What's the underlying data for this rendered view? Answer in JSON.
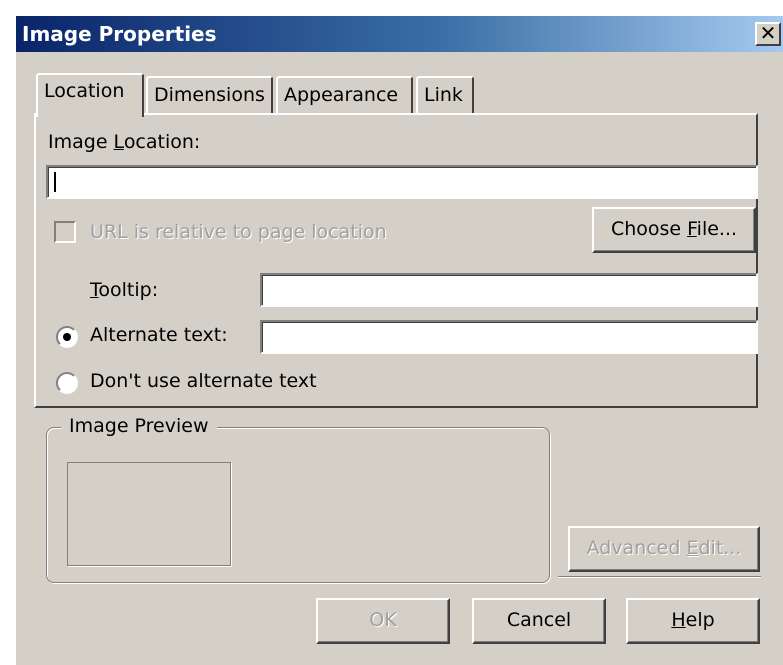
{
  "window": {
    "title": "Image Properties",
    "close_label": "✕"
  },
  "tabs": [
    {
      "label": "Location",
      "active": true
    },
    {
      "label": "Dimensions",
      "active": false
    },
    {
      "label": "Appearance",
      "active": false
    },
    {
      "label": "Link",
      "active": false
    }
  ],
  "location": {
    "image_location_label_pre": "Image ",
    "image_location_label_key": "L",
    "image_location_label_post": "ocation:",
    "image_location_value": "",
    "url_relative_label": "URL is relative to page location",
    "url_relative_checked": false,
    "choose_file_pre": "Choose ",
    "choose_file_key": "F",
    "choose_file_post": "ile...",
    "tooltip_key": "T",
    "tooltip_post": "ooltip:",
    "tooltip_value": "",
    "alt_text_label": "Alternate text:",
    "alt_text_value": "",
    "alt_text_selected": true,
    "no_alt_text_label": "Don't use alternate text",
    "no_alt_text_selected": false
  },
  "preview": {
    "legend": "Image Preview"
  },
  "buttons": {
    "advanced_edit_pre": "Advanced ",
    "advanced_edit_key": "E",
    "advanced_edit_post": "dit...",
    "ok": "OK",
    "cancel": "Cancel",
    "help_key": "H",
    "help_post": "elp"
  },
  "colors": {
    "title_gradient_start": "#0a246a",
    "title_gradient_end": "#a6caf0",
    "dialog_background": "#d4d0c8",
    "disabled_text": "#808080"
  }
}
